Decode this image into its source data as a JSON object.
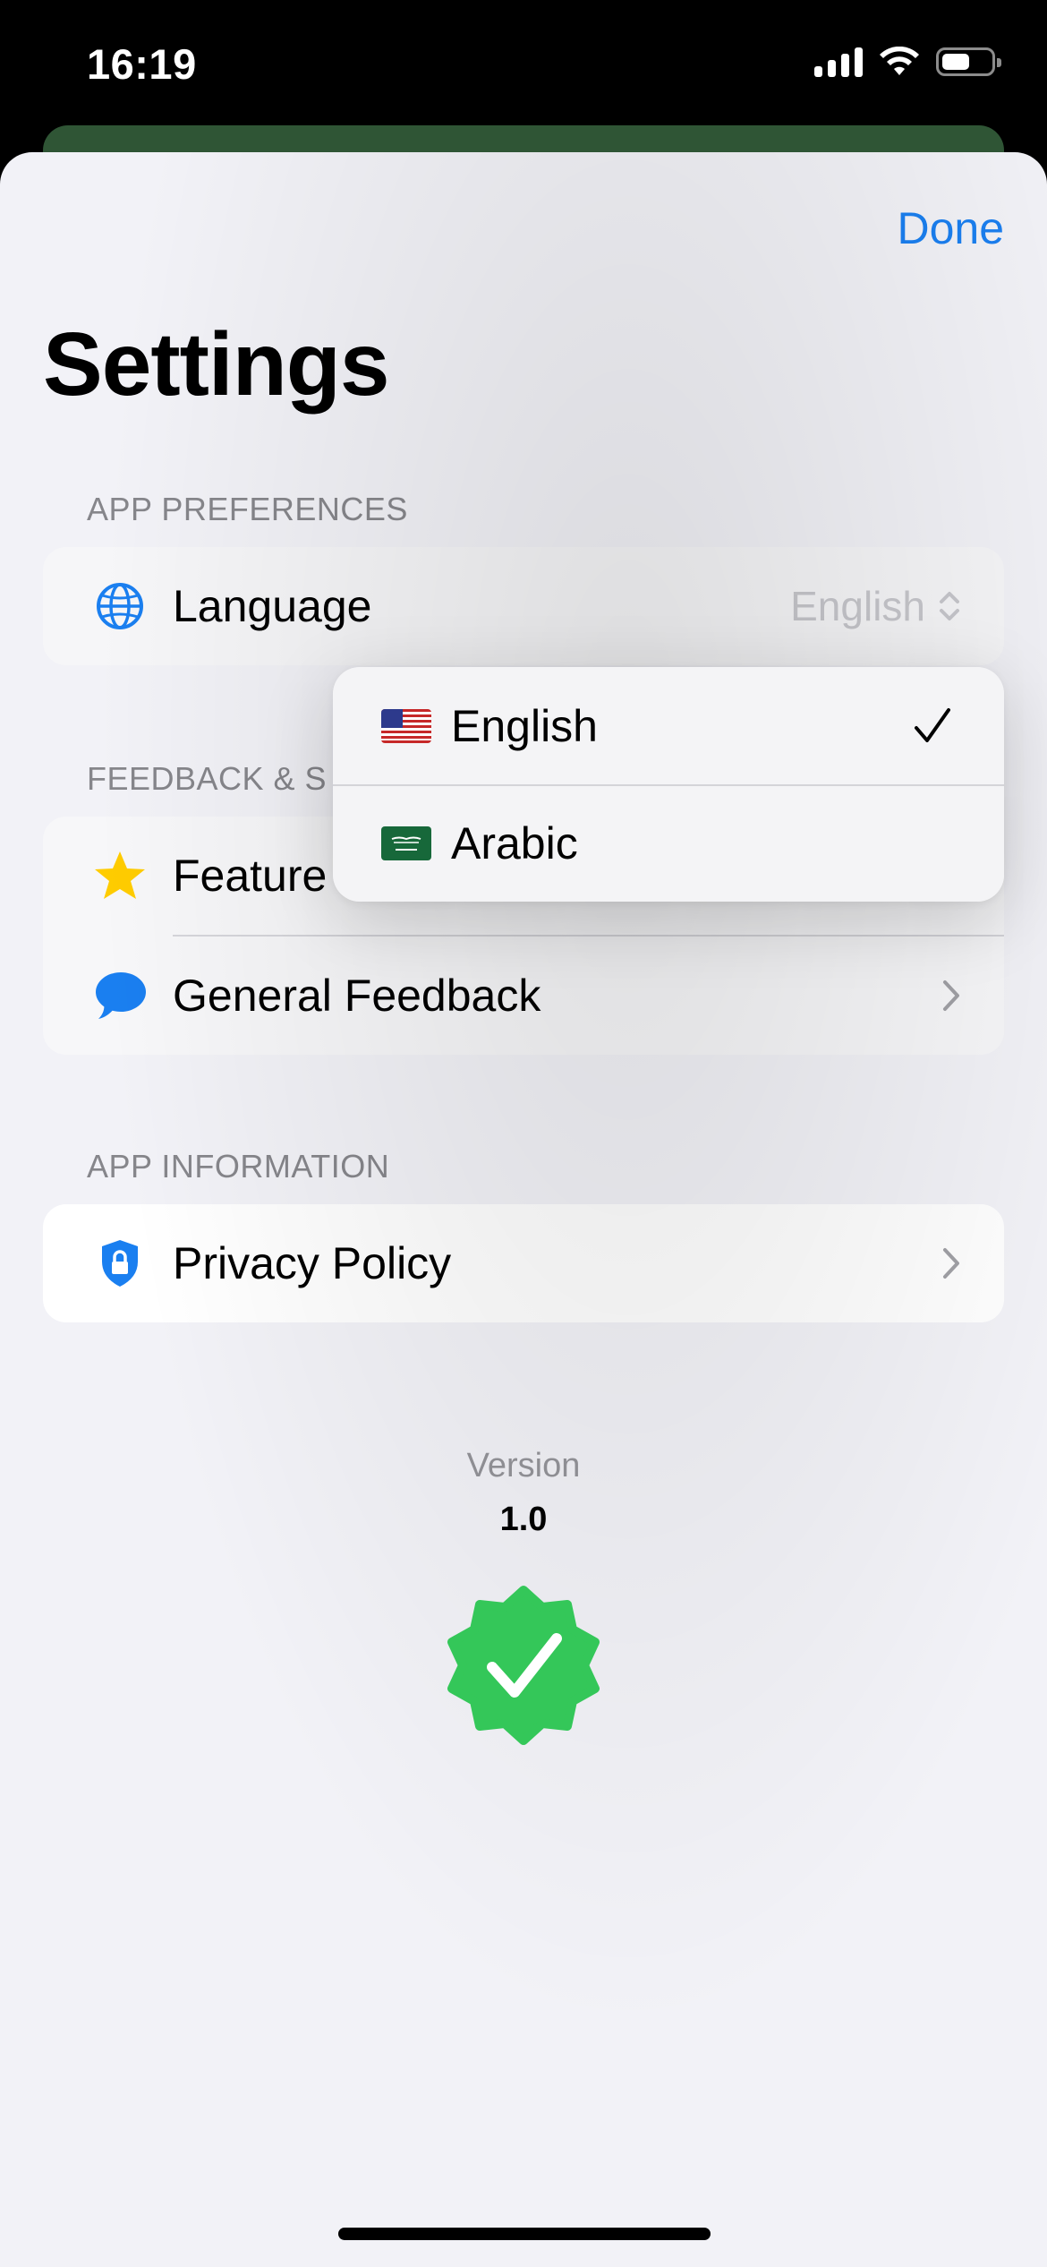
{
  "status_bar": {
    "time": "16:19",
    "icons": [
      "cellular-signal-icon",
      "wifi-icon",
      "battery-icon"
    ]
  },
  "header": {
    "done_label": "Done",
    "title": "Settings"
  },
  "sections": {
    "app_preferences": {
      "header": "APP PREFERENCES",
      "language_label": "Language",
      "language_value": "English"
    },
    "feedback": {
      "header": "FEEDBACK & S",
      "feature_label": "Feature",
      "general_feedback_label": "General Feedback"
    },
    "app_information": {
      "header": "APP INFORMATION",
      "privacy_label": "Privacy Policy"
    }
  },
  "language_menu": {
    "options": [
      {
        "label": "English",
        "flag": "us-flag-icon",
        "selected": true
      },
      {
        "label": "Arabic",
        "flag": "saudi-flag-icon",
        "selected": false
      }
    ]
  },
  "footer": {
    "version_label": "Version",
    "version_number": "1.0"
  },
  "colors": {
    "accent": "#1a7ff0",
    "background": "#f2f2f7",
    "badge_green": "#34c759",
    "star_yellow": "#ffcc00"
  }
}
